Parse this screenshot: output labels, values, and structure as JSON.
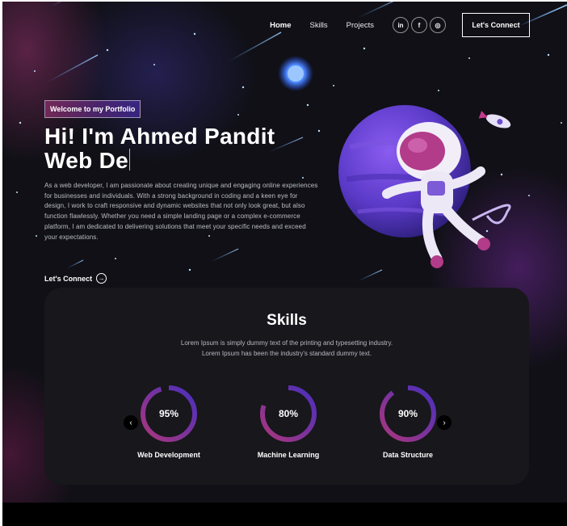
{
  "nav": {
    "links": [
      {
        "label": "Home",
        "active": true
      },
      {
        "label": "Skills",
        "active": false
      },
      {
        "label": "Projects",
        "active": false
      }
    ],
    "socials": [
      {
        "icon": "linkedin-icon",
        "glyph": "in"
      },
      {
        "icon": "facebook-icon",
        "glyph": "f"
      },
      {
        "icon": "instagram-icon",
        "glyph": "◎"
      }
    ],
    "cta_label": "Let's Connect"
  },
  "hero": {
    "tagline": "Welcome to my Portfolio",
    "title_line1": "Hi! I'm Ahmed Pandit",
    "title_line2": "Web De",
    "description": "As a web developer, I am passionate about creating unique and engaging online experiences for businesses and individuals. With a strong background in coding and a keen eye for design, I work to craft responsive and dynamic websites that not only look great, but also function flawlessly. Whether you need a simple landing page or a complex e-commerce platform, I am dedicated to delivering solutions that meet your specific needs and exceed your expectations.",
    "link_label": "Let's Connect"
  },
  "skills": {
    "title": "Skills",
    "description_line1": "Lorem Ipsum is simply dummy text of the printing and typesetting industry.",
    "description_line2": "Lorem Ipsum has been the industry's standard dummy text.",
    "items": [
      {
        "label": "Web Development",
        "value": "95%",
        "percent": 95
      },
      {
        "label": "Machine Learning",
        "value": "80%",
        "percent": 80
      },
      {
        "label": "Data Structure",
        "value": "90%",
        "percent": 90
      }
    ]
  },
  "colors": {
    "background": "#101016",
    "card": "#17171c",
    "gradient_start": "#aa367c",
    "gradient_end": "#4a2fbd"
  }
}
